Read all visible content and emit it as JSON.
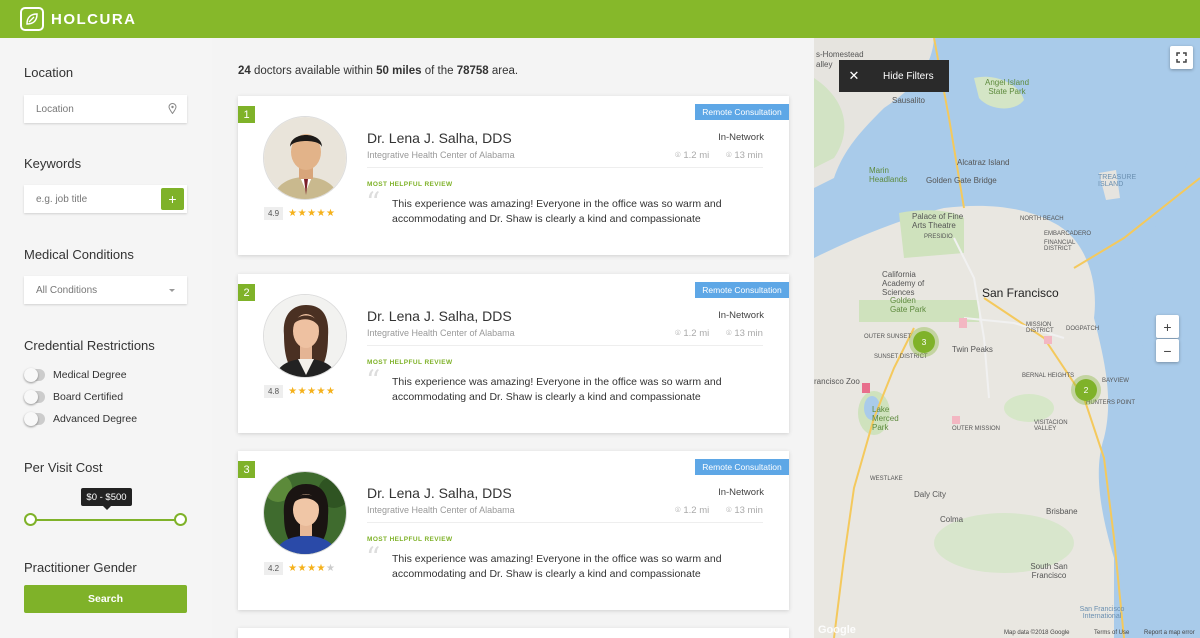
{
  "brand": {
    "name": "HOLCURA"
  },
  "sidebar": {
    "location_label": "Location",
    "location_placeholder": "Location",
    "keywords_label": "Keywords",
    "keywords_placeholder": "e.g. job title",
    "keywords_add": "+",
    "conditions_label": "Medical Conditions",
    "conditions_value": "All Conditions",
    "credential_label": "Credential Restrictions",
    "credentials": [
      {
        "label": "Medical Degree",
        "on": false
      },
      {
        "label": "Board Certified",
        "on": false
      },
      {
        "label": "Advanced Degree",
        "on": false
      }
    ],
    "cost_label": "Per Visit Cost",
    "cost_range": "$0 - $500",
    "cost_min": 0,
    "cost_max": 500,
    "gender_label": "Practitioner Gender",
    "search_label": "Search"
  },
  "results": {
    "count": "24",
    "mid1": "doctors available within",
    "radius": "50 miles",
    "mid2": "of the",
    "zip": "78758",
    "end": "area."
  },
  "cards": [
    {
      "num": "1",
      "badge": "Remote Consultation",
      "name": "Dr. Lena J. Salha, DDS",
      "clinic": "Integrative Health Center of Alabama",
      "network": "In-Network",
      "distance": "1.2 mi",
      "time": "13 min",
      "review_label": "MOST HELPFUL REVIEW",
      "review": "This experience was amazing! Everyone in the office was so warm and accommodating and Dr. Shaw is clearly a kind and compassionate",
      "rating": "4.9",
      "stars": 5
    },
    {
      "num": "2",
      "badge": "Remote Consultation",
      "name": "Dr. Lena J. Salha, DDS",
      "clinic": "Integrative Health Center of Alabama",
      "network": "In-Network",
      "distance": "1.2 mi",
      "time": "13 min",
      "review_label": "MOST HELPFUL REVIEW",
      "review": "This experience was amazing! Everyone in the office was so warm and accommodating and Dr. Shaw is clearly a kind and compassionate",
      "rating": "4.8",
      "stars": 5
    },
    {
      "num": "3",
      "badge": "Remote Consultation",
      "name": "Dr. Lena J. Salha, DDS",
      "clinic": "Integrative Health Center of Alabama",
      "network": "In-Network",
      "distance": "1.2 mi",
      "time": "13 min",
      "review_label": "MOST HELPFUL REVIEW",
      "review": "This experience was amazing! Everyone in the office was so warm and accommodating and Dr. Shaw is clearly a kind and compassionate",
      "rating": "4.2",
      "stars": 4
    }
  ],
  "map": {
    "hide_filters": "Hide Filters",
    "zoom_in": "+",
    "zoom_out": "−",
    "markers": [
      "3",
      "2"
    ],
    "labels": {
      "sf": "San Francisco",
      "sausalito": "Sausalito",
      "alcatraz": "Alcatraz Island",
      "angel": "Angel Island State Park",
      "golden_gate_bridge": "Golden Gate Bridge",
      "marin": "Marin Headlands",
      "homestead": "s-Homestead",
      "valley": "alley",
      "palace": "Palace of Fine Arts Theatre",
      "presidio": "PRESIDIO",
      "north_beach": "NORTH BEACH",
      "embarcadero": "EMBARCADERO",
      "financial": "FINANCIAL DISTRICT",
      "treasure": "TREASURE ISLAND",
      "academy": "California Academy of Sciences",
      "ggpark": "Golden Gate Park",
      "outer_sunset": "OUTER SUNSET",
      "sunset": "SUNSET DISTRICT",
      "twin_peaks": "Twin Peaks",
      "mission": "MISSION DISTRICT",
      "dogpatch": "DOGPATCH",
      "bernal": "BERNAL HEIGHTS",
      "bayview": "BAYVIEW",
      "hunters": "HUNTERS POINT",
      "zoo": "rancisco Zoo",
      "lake_merced": "Lake Merced Park",
      "outer_mission": "OUTER MISSION",
      "visitacion": "VISITACION VALLEY",
      "westlake": "WESTLAKE",
      "daly": "Daly City",
      "brisbane": "Brisbane",
      "colma": "Colma",
      "ssf": "South San Francisco",
      "sfo": "San Francisco International",
      "mapdata": "Map data ©2018 Google",
      "terms": "Terms of Use",
      "report": "Report a map error",
      "google": "Google"
    }
  },
  "colors": {
    "brand_green": "#86b82a",
    "badge_blue": "#5ea7e6",
    "star": "#f5b11b"
  }
}
